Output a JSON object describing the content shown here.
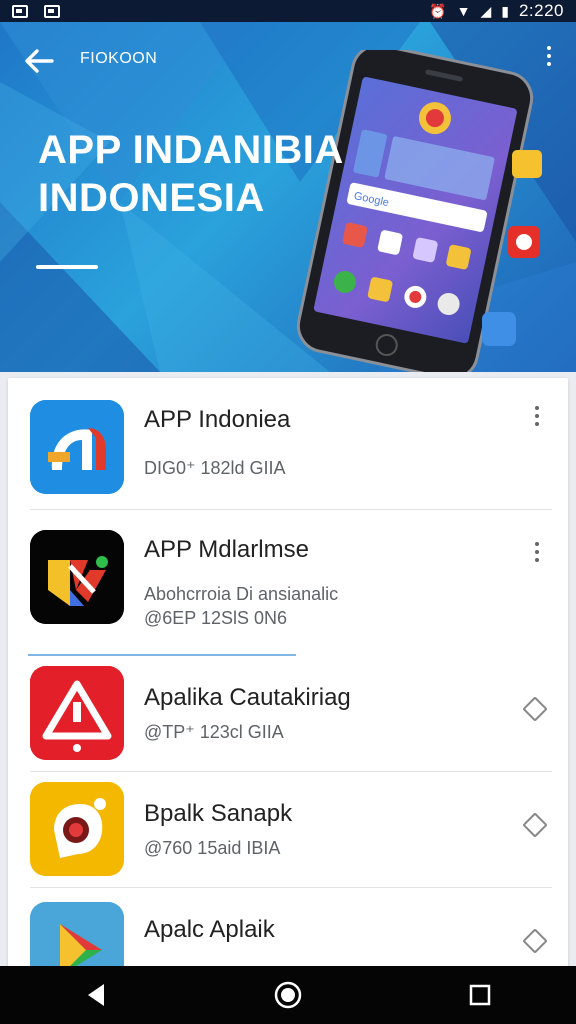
{
  "status_bar": {
    "time": "2:220"
  },
  "hero": {
    "tag": "FIOKOON",
    "title_line1": "APP INDANIBIA",
    "title_line2": "INDONESIA",
    "search_text": "Google"
  },
  "apps": [
    {
      "name": "APP Indoniea",
      "sub": "DIG0⁺ 182ld GIIA",
      "sub2": "",
      "action": "more-icon"
    },
    {
      "name": "APP Mdlarlmse",
      "sub": "Abohcrroia Di ansianalic",
      "sub2": "@6EP 12SlS 0N6",
      "action": "more-icon"
    },
    {
      "name": "Apalika Cautakiriag",
      "sub": "@TP⁺ 123cl GIIA",
      "sub2": "",
      "action": "diamond-icon"
    },
    {
      "name": "Bpalk Sanapk",
      "sub": "@760 15aid IBIA",
      "sub2": "",
      "action": "diamond-icon"
    },
    {
      "name": "Apalc Aplaik",
      "sub": "",
      "sub2": "",
      "action": "diamond-icon"
    }
  ],
  "colors": {
    "hero_blue": "#2aa2dc",
    "app1_blue": "#1f8fe0",
    "app3_red": "#e3202a",
    "app4_yellow": "#f5b800"
  }
}
